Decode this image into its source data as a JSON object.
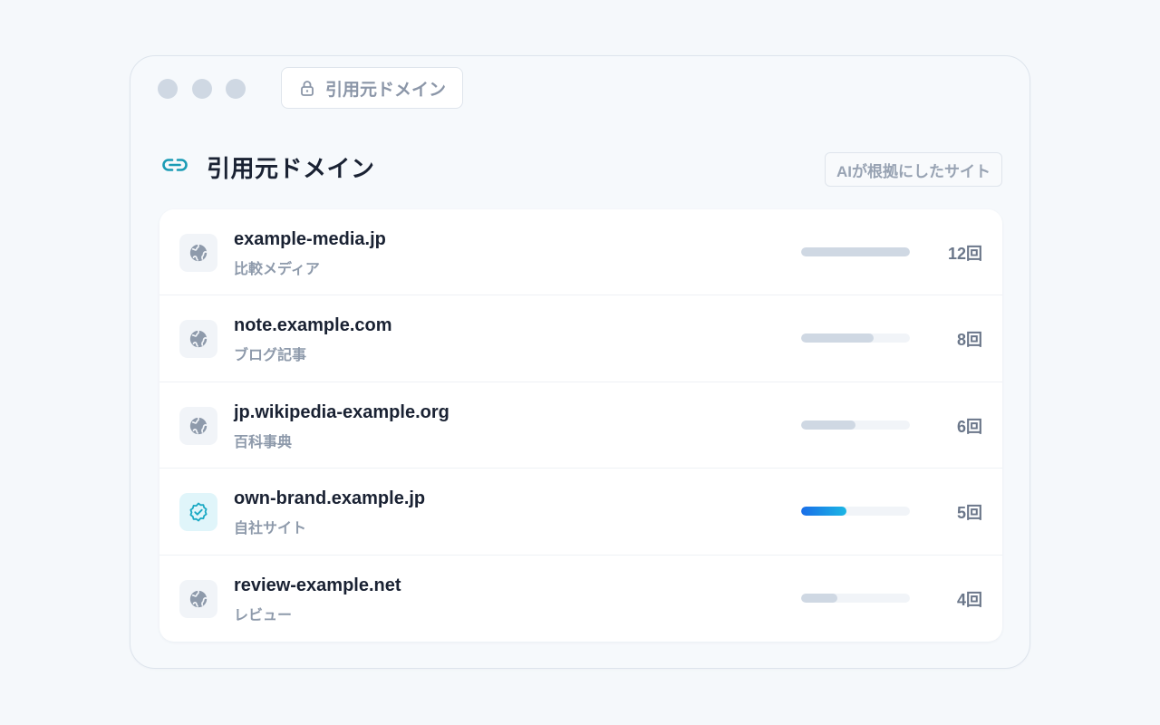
{
  "window": {
    "address_bar": {
      "icon": "lock-icon",
      "text": "引用元ドメイン"
    }
  },
  "section": {
    "icon": "link-icon",
    "title": "引用元ドメイン",
    "badge": "AIが根拠にしたサイト"
  },
  "colors": {
    "accent": "#1a9bb5",
    "bar_default": "#cfd8e3",
    "bar_own_start": "#1a6ee8",
    "bar_own_end": "#1bb6e4"
  },
  "domains": [
    {
      "domain": "example-media.jp",
      "category": "比較メディア",
      "count": "12回",
      "share": 1.0,
      "icon": "globe-icon",
      "own": false
    },
    {
      "domain": "note.example.com",
      "category": "ブログ記事",
      "count": "8回",
      "share": 0.667,
      "icon": "globe-icon",
      "own": false
    },
    {
      "domain": "jp.wikipedia-example.org",
      "category": "百科事典",
      "count": "6回",
      "share": 0.5,
      "icon": "globe-icon",
      "own": false
    },
    {
      "domain": "own-brand.example.jp",
      "category": "自社サイト",
      "count": "5回",
      "share": 0.417,
      "icon": "verified-badge-icon",
      "own": true
    },
    {
      "domain": "review-example.net",
      "category": "レビュー",
      "count": "4回",
      "share": 0.333,
      "icon": "globe-icon",
      "own": false
    }
  ]
}
